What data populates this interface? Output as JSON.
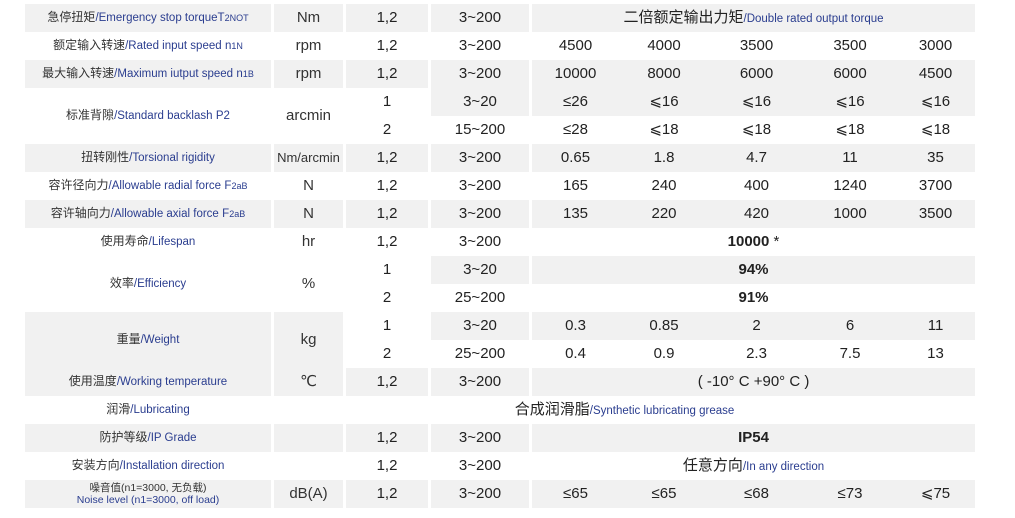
{
  "rows": {
    "emergency": {
      "cn": "急停扭矩",
      "en": "/Emergency stop torque",
      "sym": "T",
      "sub": "2NOT",
      "unit": "Nm",
      "stage": "1,2",
      "ratio": "3~200",
      "merged_cn": "二倍额定输出力矩",
      "merged_en": "/Double rated output torque"
    },
    "rated_speed": {
      "cn": "额定输入转速",
      "en": "/Rated input speed",
      "sym": "n",
      "sub": "1N",
      "unit": "rpm",
      "stage": "1,2",
      "ratio": "3~200",
      "values": [
        "4500",
        "4000",
        "3500",
        "3500",
        "3000"
      ]
    },
    "max_speed": {
      "cn": "最大输入转速",
      "en": "/Maximum iutput speed",
      "sym": "n",
      "sub": "1B",
      "unit": "rpm",
      "stage": "1,2",
      "ratio": "3~200",
      "values": [
        "10000",
        "8000",
        "6000",
        "6000",
        "4500"
      ]
    },
    "backlash": {
      "cn": "标准背隙",
      "en": "/Standard backlash",
      "sym": "P2",
      "unit": "arcmin",
      "r1": {
        "stage": "1",
        "ratio": "3~20",
        "values": [
          "≤26",
          "⩽16",
          "⩽16",
          "⩽16",
          "⩽16"
        ]
      },
      "r2": {
        "stage": "2",
        "ratio": "15~200",
        "values": [
          "≤28",
          "⩽18",
          "⩽18",
          "⩽18",
          "⩽18"
        ]
      }
    },
    "rigidity": {
      "cn": "扭转刚性",
      "en": "/Torsional rigidity",
      "unit": "Nm/arcmin",
      "stage": "1,2",
      "ratio": "3~200",
      "values": [
        "0.65",
        "1.8",
        "4.7",
        "11",
        "35"
      ]
    },
    "radial": {
      "cn": "容许径向力",
      "en": "/Allowable radial force",
      "sym": "F",
      "sub": "2aB",
      "unit": "N",
      "stage": "1,2",
      "ratio": "3~200",
      "values": [
        "165",
        "240",
        "400",
        "1240",
        "3700"
      ]
    },
    "axial": {
      "cn": "容许轴向力",
      "en": "/Allowable axial force",
      "sym": "F",
      "sub": "2aB",
      "unit": "N",
      "stage": "1,2",
      "ratio": "3~200",
      "values": [
        "135",
        "220",
        "420",
        "1000",
        "3500"
      ]
    },
    "lifespan": {
      "cn": "使用寿命",
      "en": "/Lifespan",
      "unit": "hr",
      "stage": "1,2",
      "ratio": "3~200",
      "merged": "10000",
      "mark": "*"
    },
    "efficiency": {
      "cn": "效率",
      "en": "/Efficiency",
      "unit": "%",
      "r1": {
        "stage": "1",
        "ratio": "3~20",
        "merged": "94%"
      },
      "r2": {
        "stage": "2",
        "ratio": "25~200",
        "merged": "91%"
      }
    },
    "weight": {
      "cn": "重量",
      "en": "/Weight",
      "unit": "kg",
      "r1": {
        "stage": "1",
        "ratio": "3~20",
        "values": [
          "0.3",
          "0.85",
          "2",
          "6",
          "11"
        ]
      },
      "r2": {
        "stage": "2",
        "ratio": "25~200",
        "values": [
          "0.4",
          "0.9",
          "2.3",
          "7.5",
          "13"
        ]
      }
    },
    "temperature": {
      "cn": "使用温度",
      "en": "/Working temperature",
      "unit": "℃",
      "stage": "1,2",
      "ratio": "3~200",
      "merged": "( -10°  C +90°  C )"
    },
    "lubricating": {
      "cn": "润滑",
      "en": "/Lubricating",
      "merged_cn": "合成润滑脂",
      "merged_en": "/Synthetic lubricating grease"
    },
    "ip": {
      "cn": "防护等级",
      "en": "/IP Grade",
      "stage": "1,2",
      "ratio": "3~200",
      "merged": "IP54"
    },
    "direction": {
      "cn": "安装方向",
      "en": "/Installation direction",
      "stage": "1,2",
      "ratio": "3~200",
      "merged_cn": "任意方向",
      "merged_en": "/In any direction"
    },
    "noise": {
      "cn": "噪音值(n1=3000, 无负载)",
      "en": "Noise level (n1=3000, off load)",
      "unit": "dB(A)",
      "stage": "1,2",
      "ratio": "3~200",
      "values": [
        "≤65",
        "≤65",
        "≤68",
        "≤73",
        "⩽75"
      ]
    }
  }
}
